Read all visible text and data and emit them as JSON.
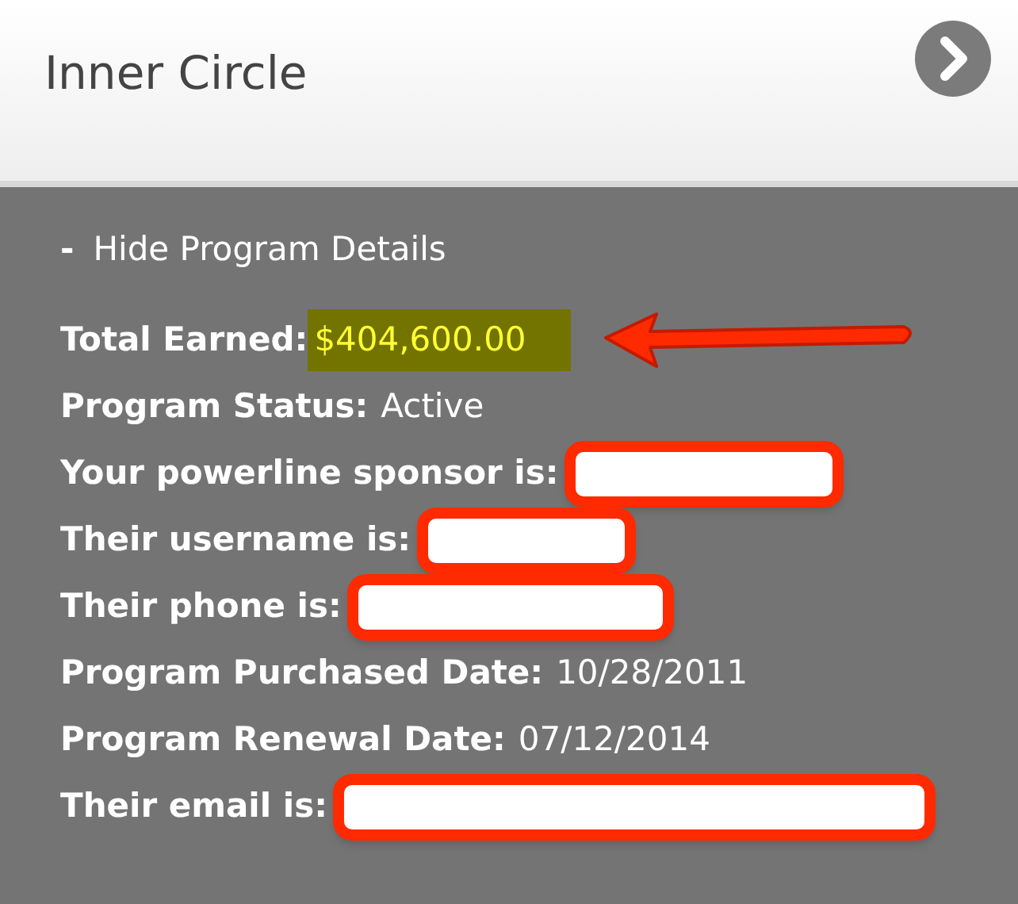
{
  "header": {
    "title": "Inner Circle"
  },
  "toggle": {
    "symbol": "-",
    "label": "Hide Program Details",
    "expanded": true
  },
  "details": [
    {
      "kind": "text",
      "label": "Total Earned:",
      "value": "$404,600.00",
      "highlighted": true
    },
    {
      "kind": "text",
      "label": "Program Status:",
      "value": "Active",
      "highlighted": false
    },
    {
      "kind": "redacted",
      "label": "Your powerline sponsor is:"
    },
    {
      "kind": "redacted",
      "label": "Their username is:"
    },
    {
      "kind": "redacted",
      "label": "Their phone is:"
    },
    {
      "kind": "text",
      "label": "Program Purchased Date:",
      "value": "10/28/2011",
      "highlighted": false
    },
    {
      "kind": "text",
      "label": "Program Renewal Date:",
      "value": "07/12/2014",
      "highlighted": false
    },
    {
      "kind": "redacted",
      "label": "Their email is:"
    }
  ]
}
